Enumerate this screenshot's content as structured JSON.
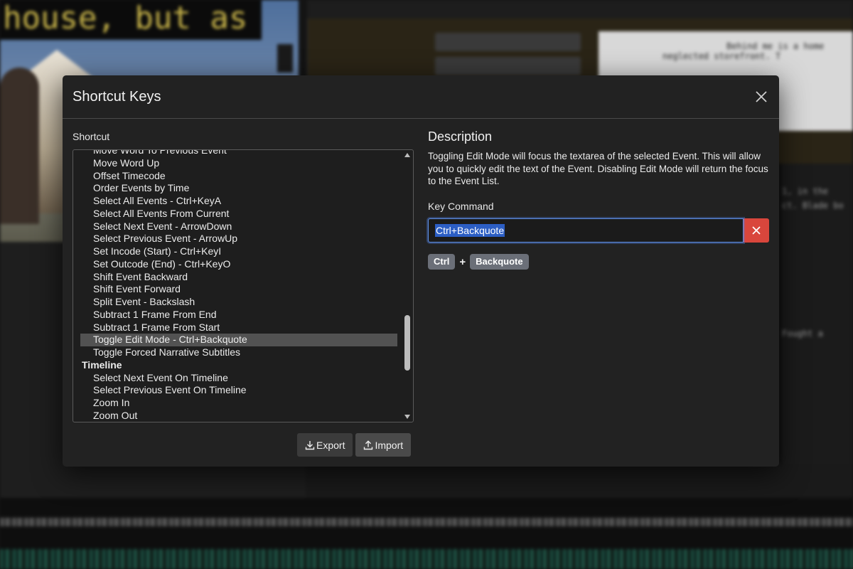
{
  "background": {
    "caption_text": "house, but as",
    "mono_lines": [
      "Behind me is a home",
      "neglected storefront. T",
      "1, in the",
      "ct. Blade bo",
      "Fought a"
    ]
  },
  "modal": {
    "title": "Shortcut Keys",
    "close_icon": "close-icon",
    "shortcut_label": "Shortcut",
    "shortcuts": [
      {
        "label": "Move Word To Previous Event",
        "type": "item"
      },
      {
        "label": "Move Word Up",
        "type": "item"
      },
      {
        "label": "Offset Timecode",
        "type": "item"
      },
      {
        "label": "Order Events by Time",
        "type": "item"
      },
      {
        "label": "Select All Events - Ctrl+KeyA",
        "type": "item"
      },
      {
        "label": "Select All Events From Current",
        "type": "item"
      },
      {
        "label": "Select Next Event - ArrowDown",
        "type": "item"
      },
      {
        "label": "Select Previous Event - ArrowUp",
        "type": "item"
      },
      {
        "label": "Set Incode (Start) - Ctrl+KeyI",
        "type": "item"
      },
      {
        "label": "Set Outcode (End) - Ctrl+KeyO",
        "type": "item"
      },
      {
        "label": "Shift Event Backward",
        "type": "item"
      },
      {
        "label": "Shift Event Forward",
        "type": "item"
      },
      {
        "label": "Split Event - Backslash",
        "type": "item"
      },
      {
        "label": "Subtract 1 Frame From End",
        "type": "item"
      },
      {
        "label": "Subtract 1 Frame From Start",
        "type": "item"
      },
      {
        "label": "Toggle Edit Mode - Ctrl+Backquote",
        "type": "item",
        "selected": true
      },
      {
        "label": "Toggle Forced Narrative Subtitles",
        "type": "item"
      },
      {
        "label": "Timeline",
        "type": "group"
      },
      {
        "label": "Select Next Event On Timeline",
        "type": "item"
      },
      {
        "label": "Select Previous Event On Timeline",
        "type": "item"
      },
      {
        "label": "Zoom In",
        "type": "item"
      },
      {
        "label": "Zoom Out",
        "type": "item"
      }
    ],
    "export_label": "Export",
    "import_label": "Import",
    "export_icon": "download-icon",
    "import_icon": "upload-icon",
    "description_title": "Description",
    "description_text": "Toggling Edit Mode will focus the textarea of the selected Event. This will allow you to quickly edit the text of the Event. Disabling Edit Mode will return the focus to the Event List.",
    "key_command_label": "Key Command",
    "key_command_value": "Ctrl+Backquote",
    "key_chips": [
      "Ctrl",
      "Backquote"
    ],
    "key_separator": "+",
    "colors": {
      "modal_bg": "#222222",
      "selected_row": "#525252",
      "clear_button": "#d9463c",
      "input_focus": "#5d8fe6",
      "chip_bg": "#6b6f78"
    }
  }
}
